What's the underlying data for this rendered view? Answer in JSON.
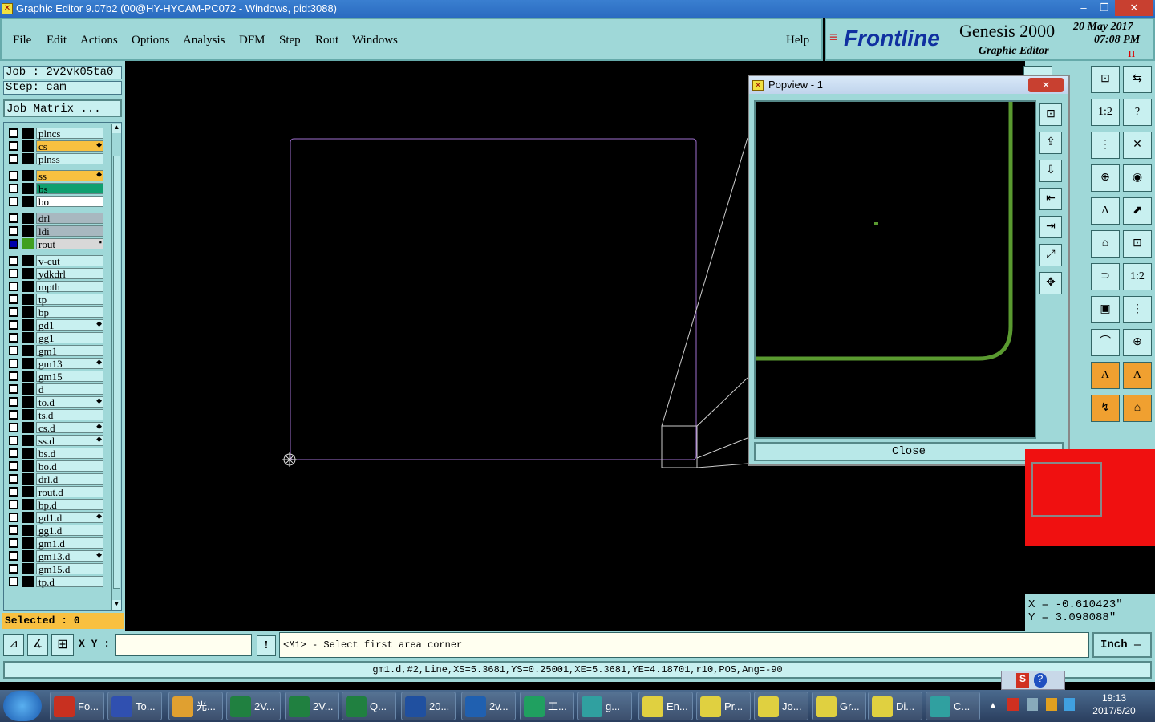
{
  "window": {
    "title": "Graphic Editor 9.07b2 (00@HY-HYCAM-PC072 - Windows, pid:3088)"
  },
  "menu": [
    "File",
    "Edit",
    "Actions",
    "Options",
    "Analysis",
    "DFM",
    "Step",
    "Rout",
    "Windows"
  ],
  "help": "Help",
  "logo": {
    "brand": "Frontline",
    "product": "Genesis 2000",
    "subtitle": "Graphic Editor",
    "date": "20 May 2017",
    "time": "07:08 PM",
    "pause": "II"
  },
  "job": {
    "job": "Job : 2v2vk05ta0",
    "step": "Step: cam",
    "matrix": "Job Matrix ..."
  },
  "layers": [
    {
      "name": "plncs",
      "bg": "#c8f0f0",
      "mark": ""
    },
    {
      "name": "cs",
      "bg": "#f8c040",
      "mark": "◆"
    },
    {
      "name": "plnss",
      "bg": "#c8f0f0",
      "mark": ""
    },
    {
      "name": "ss",
      "bg": "#f8c040",
      "mark": "◆"
    },
    {
      "name": "bs",
      "bg": "#10a070",
      "mark": ""
    },
    {
      "name": "bo",
      "bg": "#ffffff",
      "mark": ""
    },
    {
      "name": "drl",
      "bg": "#a8b8c0",
      "mark": ""
    },
    {
      "name": "ldi",
      "bg": "#a8b8c0",
      "mark": ""
    },
    {
      "name": "rout",
      "bg": "#d8d8d8",
      "mark": "▪"
    },
    {
      "name": "v-cut",
      "bg": "#c8f0f0",
      "mark": ""
    },
    {
      "name": "ydkdrl",
      "bg": "#c8f0f0",
      "mark": ""
    },
    {
      "name": "mpth",
      "bg": "#c8f0f0",
      "mark": ""
    },
    {
      "name": "tp",
      "bg": "#c8f0f0",
      "mark": ""
    },
    {
      "name": "bp",
      "bg": "#c8f0f0",
      "mark": ""
    },
    {
      "name": "gd1",
      "bg": "#c8f0f0",
      "mark": "◆"
    },
    {
      "name": "gg1",
      "bg": "#c8f0f0",
      "mark": ""
    },
    {
      "name": "gm1",
      "bg": "#c8f0f0",
      "mark": ""
    },
    {
      "name": "gm13",
      "bg": "#c8f0f0",
      "mark": "◆"
    },
    {
      "name": "gm15",
      "bg": "#c8f0f0",
      "mark": ""
    },
    {
      "name": "d",
      "bg": "#c8f0f0",
      "mark": ""
    },
    {
      "name": "to.d",
      "bg": "#c8f0f0",
      "mark": "◆"
    },
    {
      "name": "ts.d",
      "bg": "#c8f0f0",
      "mark": ""
    },
    {
      "name": "cs.d",
      "bg": "#c8f0f0",
      "mark": "◆"
    },
    {
      "name": "ss.d",
      "bg": "#c8f0f0",
      "mark": "◆"
    },
    {
      "name": "bs.d",
      "bg": "#c8f0f0",
      "mark": ""
    },
    {
      "name": "bo.d",
      "bg": "#c8f0f0",
      "mark": ""
    },
    {
      "name": "drl.d",
      "bg": "#c8f0f0",
      "mark": ""
    },
    {
      "name": "rout.d",
      "bg": "#c8f0f0",
      "mark": ""
    },
    {
      "name": "bp.d",
      "bg": "#c8f0f0",
      "mark": ""
    },
    {
      "name": "gd1.d",
      "bg": "#c8f0f0",
      "mark": "◆"
    },
    {
      "name": "gg1.d",
      "bg": "#c8f0f0",
      "mark": ""
    },
    {
      "name": "gm1.d",
      "bg": "#c8f0f0",
      "mark": ""
    },
    {
      "name": "gm13.d",
      "bg": "#c8f0f0",
      "mark": "◆"
    },
    {
      "name": "gm15.d",
      "bg": "#c8f0f0",
      "mark": ""
    },
    {
      "name": "tp.d",
      "bg": "#c8f0f0",
      "mark": ""
    }
  ],
  "selected": "Selected : 0",
  "popview": {
    "title": "Popview - 1",
    "close_label": "Close",
    "x_label": "✕"
  },
  "coords": {
    "x": "X = -0.610423\"",
    "y": "Y = 3.098088\""
  },
  "cmd": {
    "xy_label": "X Y :",
    "prompt": "<M1> - Select first area corner",
    "unit": "Inch ═"
  },
  "status": "gm1.d,#2,Line,XS=5.3681,YS=0.25001,XE=5.3681,YE=4.18701,r10,POS,Ang=-90",
  "taskbar": {
    "items": [
      {
        "label": "Fo...",
        "color": "#c83020"
      },
      {
        "label": "To...",
        "color": "#3050b0"
      },
      {
        "label": "光...",
        "color": "#e0a030"
      },
      {
        "label": "2V...",
        "color": "#208040"
      },
      {
        "label": "2V...",
        "color": "#208040"
      },
      {
        "label": "Q...",
        "color": "#208040"
      },
      {
        "label": "20...",
        "color": "#2050a0"
      },
      {
        "label": "2v...",
        "color": "#2060b0"
      },
      {
        "label": "工...",
        "color": "#20a060"
      },
      {
        "label": "g...",
        "color": "#30a0a0"
      },
      {
        "label": "En...",
        "color": "#e0d040"
      },
      {
        "label": "Pr...",
        "color": "#e0d040"
      },
      {
        "label": "Jo...",
        "color": "#e0d040"
      },
      {
        "label": "Gr...",
        "color": "#e0d040"
      },
      {
        "label": "Di...",
        "color": "#e0d040"
      },
      {
        "label": "C...",
        "color": "#30a0a0"
      }
    ],
    "time": "19:13",
    "date": "2017/5/20"
  }
}
